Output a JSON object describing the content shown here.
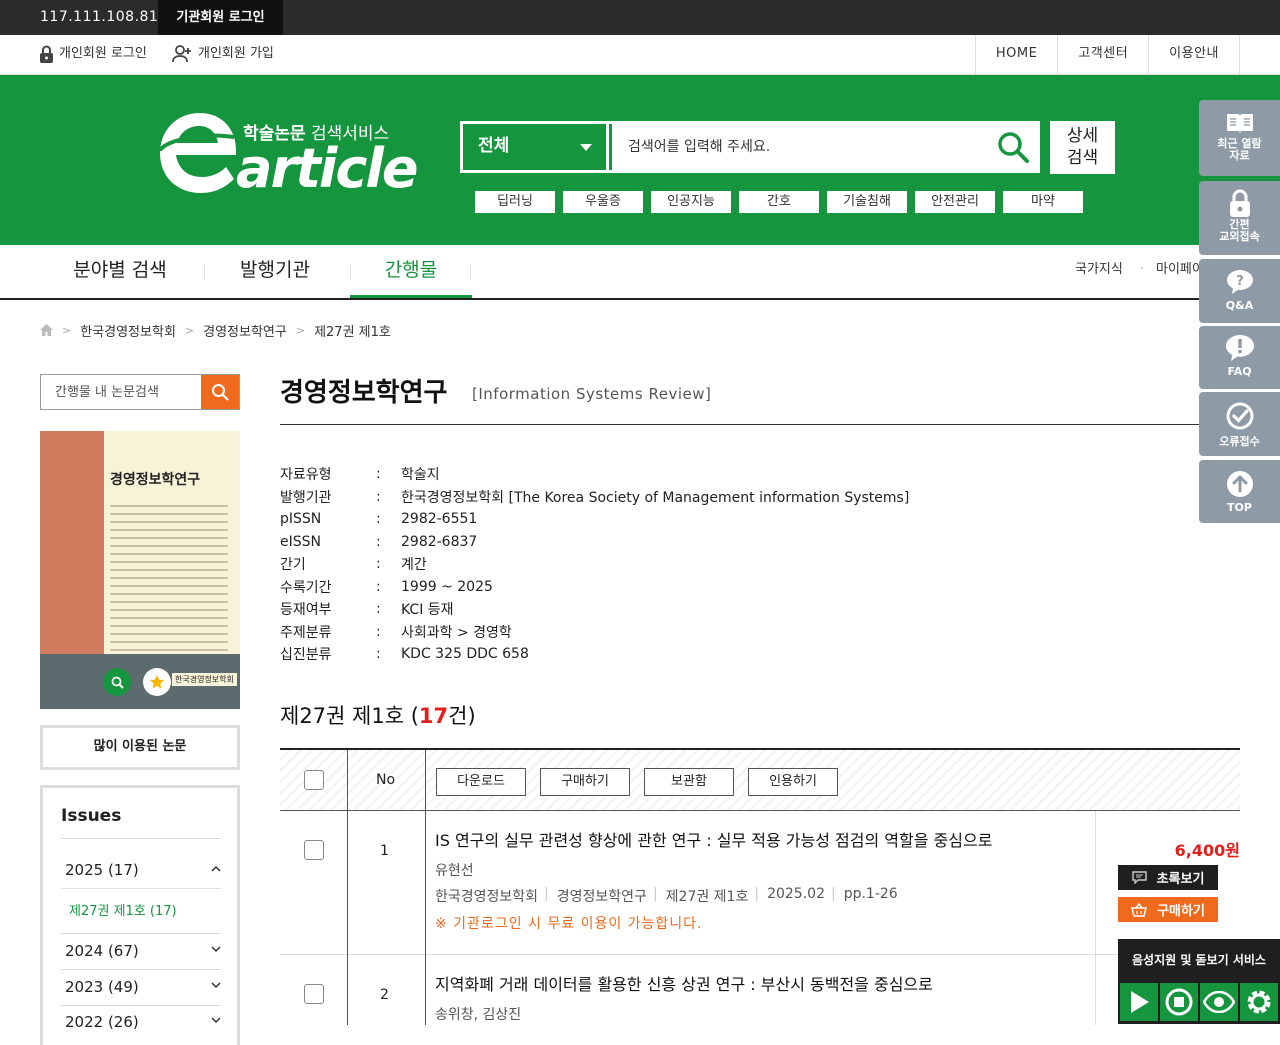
{
  "topbar": {
    "ip": "117.111.108.81",
    "institution_login": "기관회원 로그인"
  },
  "util": {
    "login": "개인회원 로그인",
    "signup": "개인회원 가입",
    "nav": [
      "HOME",
      "고객센터",
      "이용안내"
    ]
  },
  "logo": {
    "sub_bold": "학술논문",
    "sub_rest": " 검색서비스",
    "word": "article"
  },
  "search": {
    "category": "전체",
    "placeholder": "검색어를 입력해 주세요.",
    "advanced": "상세\n검색",
    "tags": [
      "딥러닝",
      "우울증",
      "인공지능",
      "간호",
      "기술침해",
      "안전관리",
      "마약"
    ]
  },
  "mainnav": {
    "items": [
      "분야별 검색",
      "발행기관",
      "간행물"
    ],
    "sub": [
      "국가지식",
      "마이페이"
    ]
  },
  "breadcrumb": [
    "한국경영정보학회",
    "경영정보학연구",
    "제27권 제1호"
  ],
  "sidebar": {
    "search_placeholder": "간행물 내 논문검색",
    "cover_title": "경영정보학연구",
    "cover_pub": "한국경영정보학회",
    "popular": "많이 이용된 논문",
    "issues_title": "Issues",
    "years": [
      "2025 (17)",
      "2024 (67)",
      "2023 (49)",
      "2022 (26)"
    ],
    "current_issue": "제27권 제1호 (17)"
  },
  "journal": {
    "title": "경영정보학연구",
    "title_en": "[Information Systems Review]",
    "meta": [
      {
        "k": "자료유형",
        "v": "학술지"
      },
      {
        "k": "발행기관",
        "v": "한국경영정보학회 [The Korea Society of Management information Systems]"
      },
      {
        "k": "pISSN",
        "v": "2982-6551"
      },
      {
        "k": "eISSN",
        "v": "2982-6837"
      },
      {
        "k": "간기",
        "v": "계간"
      },
      {
        "k": "수록기간",
        "v": "1999 ~ 2025"
      },
      {
        "k": "등재여부",
        "v": "KCI 등재"
      },
      {
        "k": "주제분류",
        "v": "사회과학 > 경영학"
      },
      {
        "k": "십진분류",
        "v": "KDC 325 DDC 658"
      }
    ],
    "colon": ":"
  },
  "volume": {
    "prefix": "제27권 제1호 (",
    "count": "17",
    "suffix": "건)"
  },
  "table": {
    "no_header": "No",
    "buttons": [
      "다운로드",
      "구매하기",
      "보관함",
      "인용하기"
    ]
  },
  "articles": [
    {
      "no": "1",
      "title": "IS 연구의 실무 관련성 향상에 관한 연구 : 실무 적용 가능성 점검의 역할을 중심으로",
      "authors": "유현선",
      "publisher": "한국경영정보학회",
      "journal": "경영정보학연구",
      "issue": "제27권 제1호",
      "date": "2025.02",
      "pages": "pp.1-26",
      "note": "※ 기관로그인 시 무료 이용이 가능합니다.",
      "price": "6,400원",
      "abstract_btn": "초록보기",
      "buy_btn": "구매하기"
    },
    {
      "no": "2",
      "title": "지역화폐 거래 데이터를 활용한 신흥 상권 연구 : 부산시 동백전을 중심으로",
      "authors": "송위창, 김상진"
    }
  ],
  "quickmenu": [
    {
      "label": "최근 열람\n자료",
      "icon": "book-icon"
    },
    {
      "label": "간편\n교외접속",
      "icon": "lock-icon"
    },
    {
      "label": "Q&A",
      "icon": "question-icon"
    },
    {
      "label": "FAQ",
      "icon": "exclamation-icon"
    },
    {
      "label": "오류접수",
      "icon": "check-icon"
    },
    {
      "label": "TOP",
      "icon": "arrow-up-icon"
    }
  ],
  "voice": {
    "title": "음성지원 및 돋보기 서비스"
  },
  "colors": {
    "green": "#16953f",
    "orange": "#f06a1d",
    "red": "#e0201b",
    "quick": "#8e9ba7"
  }
}
